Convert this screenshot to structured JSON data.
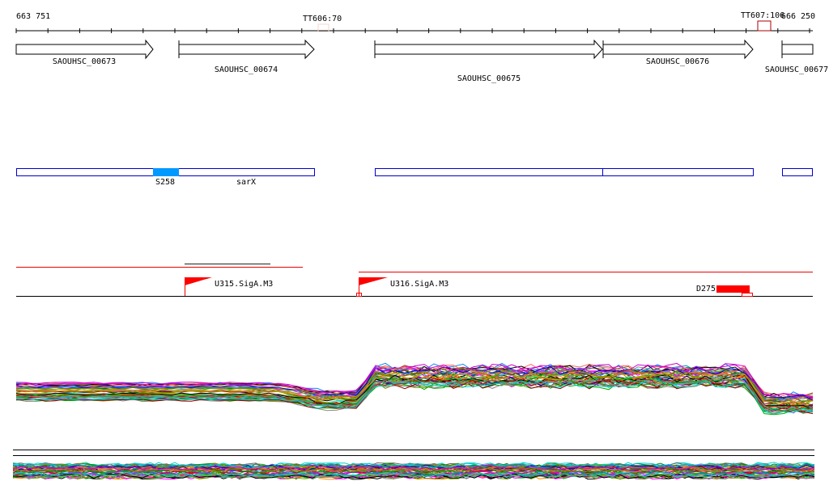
{
  "ruler": {
    "start": "663 751",
    "end": "666 250",
    "terminators": [
      "TT606:70",
      "TT607:106"
    ]
  },
  "genes": [
    "SAOUHSC_00673",
    "SAOUHSC_00674",
    "SAOUHSC_00675",
    "SAOUHSC_00676",
    "SAOUHSC_00677"
  ],
  "features": {
    "s_label": "S258",
    "srna_label": "sarX"
  },
  "promoters": [
    "U315.SigA.M3",
    "U316.SigA.M3"
  ],
  "downstream": {
    "label": "D275"
  },
  "colors": {
    "accent": "#ff0000",
    "feature_box": "#0000cc",
    "feature_fill": "#0099ff"
  }
}
